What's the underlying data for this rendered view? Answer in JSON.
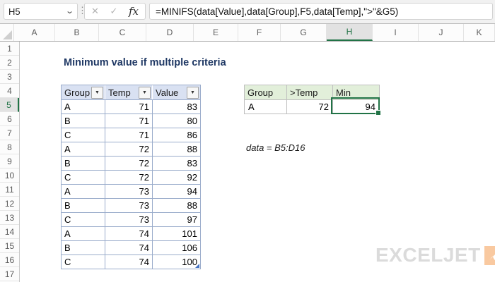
{
  "formula_bar": {
    "cell_reference": "H5",
    "formula": "=MINIFS(data[Value],data[Group],F5,data[Temp],\">\"&G5)",
    "cancel_label": "✕",
    "enter_label": "✓",
    "fx_label": "fx",
    "name_box_chevron": "⌄",
    "handle_dots": "⋮"
  },
  "grid": {
    "column_headers": [
      "A",
      "B",
      "C",
      "D",
      "E",
      "F",
      "G",
      "H",
      "I",
      "J",
      "K"
    ],
    "selected_column": "H",
    "row_headers": [
      "1",
      "2",
      "3",
      "4",
      "5",
      "6",
      "7",
      "8",
      "9",
      "10",
      "11",
      "12",
      "13",
      "14",
      "15",
      "16",
      "17"
    ],
    "selected_row": "5"
  },
  "sheet": {
    "title": "Minimum value if multiple criteria",
    "annotation": "data = B5:D16"
  },
  "data_table": {
    "headers": [
      "Group",
      "Temp",
      "Value"
    ],
    "filter_icon": "▼",
    "rows": [
      [
        "A",
        "71",
        "83"
      ],
      [
        "B",
        "71",
        "80"
      ],
      [
        "C",
        "71",
        "86"
      ],
      [
        "A",
        "72",
        "88"
      ],
      [
        "B",
        "72",
        "83"
      ],
      [
        "C",
        "72",
        "92"
      ],
      [
        "A",
        "73",
        "94"
      ],
      [
        "B",
        "73",
        "88"
      ],
      [
        "C",
        "73",
        "97"
      ],
      [
        "A",
        "74",
        "101"
      ],
      [
        "B",
        "74",
        "106"
      ],
      [
        "C",
        "74",
        "100"
      ]
    ]
  },
  "criteria_table": {
    "headers": [
      "Group",
      ">Temp",
      "Min"
    ],
    "rows": [
      [
        "A",
        "72",
        "94"
      ]
    ]
  },
  "branding": {
    "logo_text": "EXCELJET"
  },
  "colors": {
    "selection_green": "#217346",
    "table_header_blue": "#d9e1f2",
    "table_border_blue": "#9aaccb",
    "criteria_header_green": "#e2efda",
    "criteria_border_gray": "#bfbfbf",
    "title_blue": "#1f3864",
    "logo_gray": "#dbdbdb",
    "logo_orange": "#f9c9a0"
  }
}
